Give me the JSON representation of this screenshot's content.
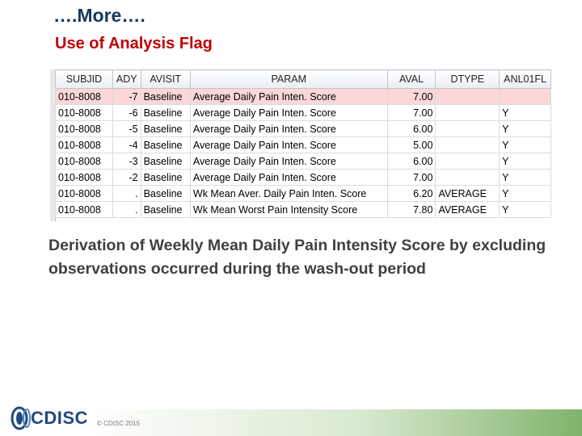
{
  "header": {
    "title": "….More….",
    "subtitle": "Use of Analysis Flag"
  },
  "table": {
    "columns": [
      "SUBJID",
      "ADY",
      "AVISIT",
      "PARAM",
      "AVAL",
      "DTYPE",
      "ANL01FL"
    ],
    "rows": [
      [
        "010-8008",
        "-7",
        "Baseline",
        "Average Daily Pain Inten. Score",
        "7.00",
        "",
        ""
      ],
      [
        "010-8008",
        "-6",
        "Baseline",
        "Average Daily Pain Inten. Score",
        "7.00",
        "",
        "Y"
      ],
      [
        "010-8008",
        "-5",
        "Baseline",
        "Average Daily Pain Inten. Score",
        "6.00",
        "",
        "Y"
      ],
      [
        "010-8008",
        "-4",
        "Baseline",
        "Average Daily Pain Inten. Score",
        "5.00",
        "",
        "Y"
      ],
      [
        "010-8008",
        "-3",
        "Baseline",
        "Average Daily Pain Inten. Score",
        "6.00",
        "",
        "Y"
      ],
      [
        "010-8008",
        "-2",
        "Baseline",
        "Average Daily Pain Inten. Score",
        "7.00",
        "",
        "Y"
      ],
      [
        "010-8008",
        ".",
        "Baseline",
        "Wk Mean Aver. Daily Pain Inten. Score",
        "6.20",
        "AVERAGE",
        "Y"
      ],
      [
        "010-8008",
        ".",
        "Baseline",
        "Wk Mean Worst Pain Intensity Score",
        "7.80",
        "AVERAGE",
        "Y"
      ]
    ],
    "selected_row": 0
  },
  "description": "Derivation of Weekly Mean Daily Pain Intensity Score by excluding observations occurred during the wash-out period",
  "footer": {
    "logo_text": "CDISC",
    "copyright": "© CDISC 2015"
  },
  "colors": {
    "title": "#17375e",
    "subtitle": "#c00000",
    "selected_row": "#fbd7d7",
    "footer_accent": "#7fb36b"
  }
}
